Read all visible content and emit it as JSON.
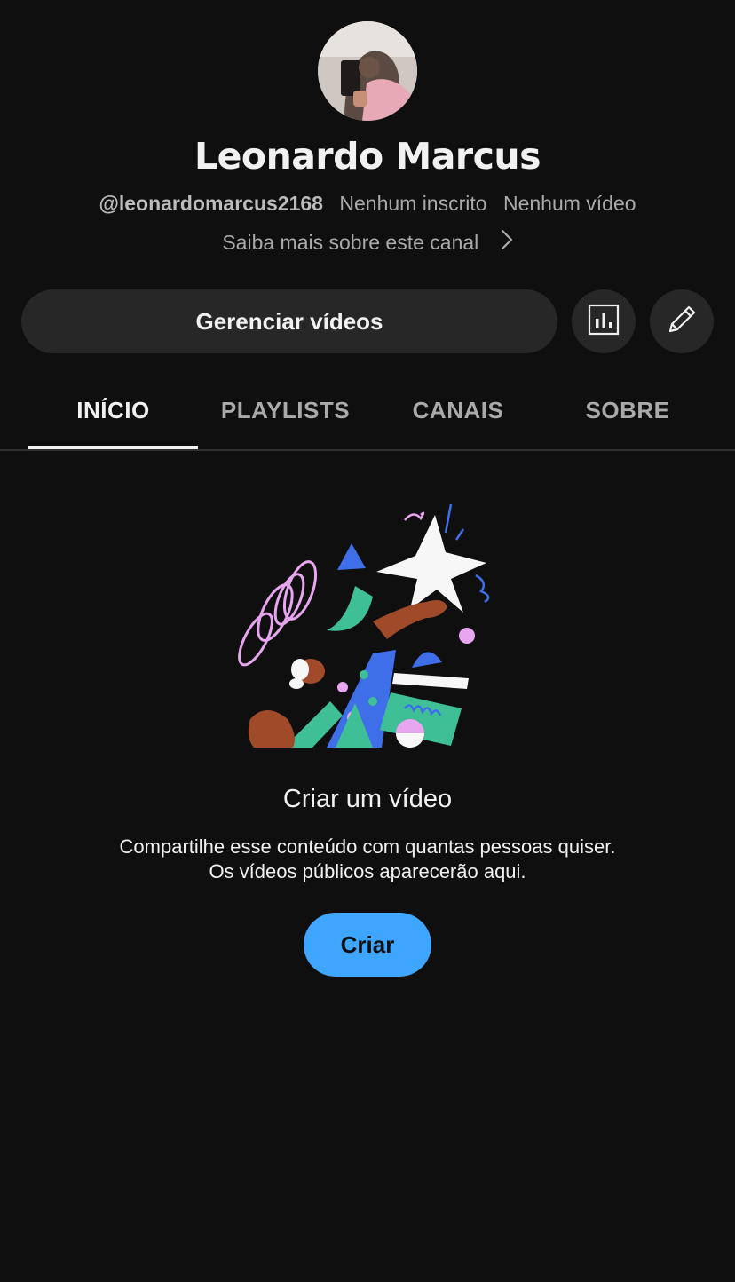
{
  "channel": {
    "name": "Leonardo Marcus",
    "handle": "@leonardomarcus2168",
    "subscribers": "Nenhum inscrito",
    "videos": "Nenhum vídeo",
    "more_link": "Saiba mais sobre este canal"
  },
  "actions": {
    "manage_label": "Gerenciar vídeos",
    "stats_icon": "bar-chart-icon",
    "edit_icon": "pencil-icon"
  },
  "tabs": [
    {
      "label": "INÍCIO",
      "active": true
    },
    {
      "label": "PLAYLISTS",
      "active": false
    },
    {
      "label": "CANAIS",
      "active": false
    },
    {
      "label": "SOBRE",
      "active": false
    }
  ],
  "empty_state": {
    "title": "Criar um vídeo",
    "line1": "Compartilhe esse conteúdo com quantas pessoas quiser.",
    "line2": "Os vídeos públicos aparecerão aqui.",
    "button_label": "Criar"
  },
  "colors": {
    "background": "#0f0f0f",
    "button_bg": "#272727",
    "accent": "#3ea6ff",
    "muted_text": "#aaaaaa"
  }
}
